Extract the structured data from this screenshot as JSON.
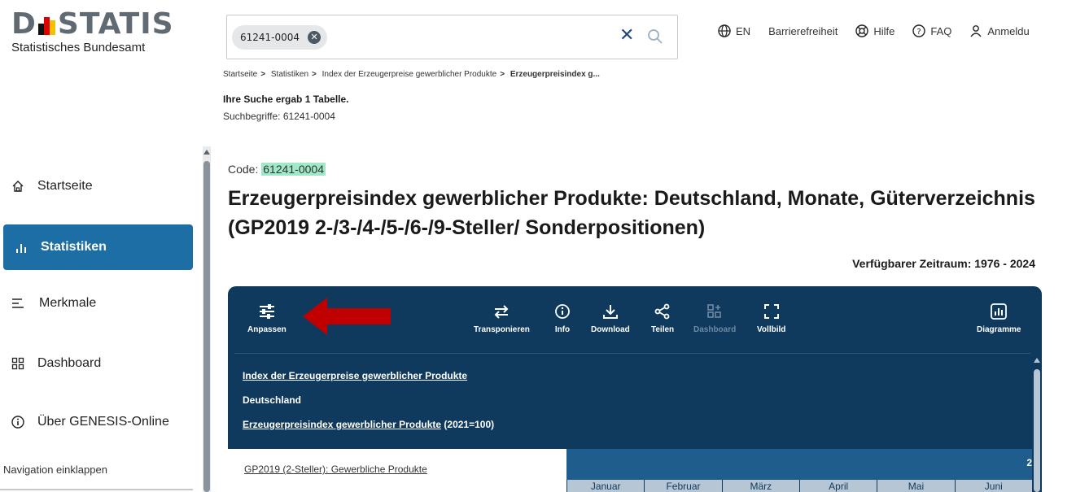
{
  "logo": {
    "wordmark": "DESTATIS",
    "wordmark_left": "D",
    "wordmark_right": "STATIS",
    "subtitle": "Statistisches Bundesamt"
  },
  "search": {
    "chip_value": "61241-0004"
  },
  "topnav": {
    "language": "EN",
    "accessibility": "Barrierefreiheit",
    "help": "Hilfe",
    "faq": "FAQ",
    "login": "Anmeldu"
  },
  "breadcrumb": {
    "items": [
      "Startseite",
      "Statistiken",
      "Index der Erzeugerpreise gewerblicher Produkte"
    ],
    "current": "Erzeugerpreisindex g..."
  },
  "result": {
    "summary": "Ihre Suche ergab 1 Tabelle.",
    "terms": "Suchbegriffe: 61241-0004"
  },
  "sidebar": {
    "items": [
      {
        "label": "Startseite",
        "icon": "home-icon"
      },
      {
        "label": "Statistiken",
        "icon": "bar-chart-icon",
        "active": true
      },
      {
        "label": "Merkmale",
        "icon": "list-icon"
      },
      {
        "label": "Dashboard",
        "icon": "dashboard-icon"
      },
      {
        "label": "Über GENESIS-Online",
        "icon": "info-icon"
      }
    ],
    "collapse_label": "Navigation einklappen"
  },
  "main": {
    "code_label": "Code: ",
    "code_value": "61241-0004",
    "title": "Erzeugerpreisindex gewerblicher Produkte: Deutschland, Monate, Güterverzeichnis (GP2019 2-/3-/4-/5-/6-/9-Steller/ Sonderpositionen)",
    "period": "Verfügbarer Zeitraum: 1976 - 2024"
  },
  "toolbar": {
    "anpassen": "Anpassen",
    "transponieren": "Transponieren",
    "info": "Info",
    "download": "Download",
    "teilen": "Teilen",
    "dashboard": "Dashboard",
    "vollbild": "Vollbild",
    "diagramme": "Diagramme"
  },
  "table": {
    "header_line1": "Index der Erzeugerpreise gewerblicher Produkte",
    "header_line2": "Deutschland",
    "header_line3_link": "Erzeugerpreisindex gewerblicher Produkte",
    "header_line3_suffix": " (2021=100)",
    "row_label": "GP2019 (2-Steller): Gewerbliche Produkte",
    "year_fragment": "2",
    "months": [
      "Januar",
      "Februar",
      "März",
      "April",
      "Mai",
      "Juni"
    ]
  },
  "colors": {
    "panel_bg": "#0f3a5d",
    "active_nav": "#1c6ea4",
    "code_highlight": "#9fe8c8",
    "arrow": "#c00000"
  }
}
